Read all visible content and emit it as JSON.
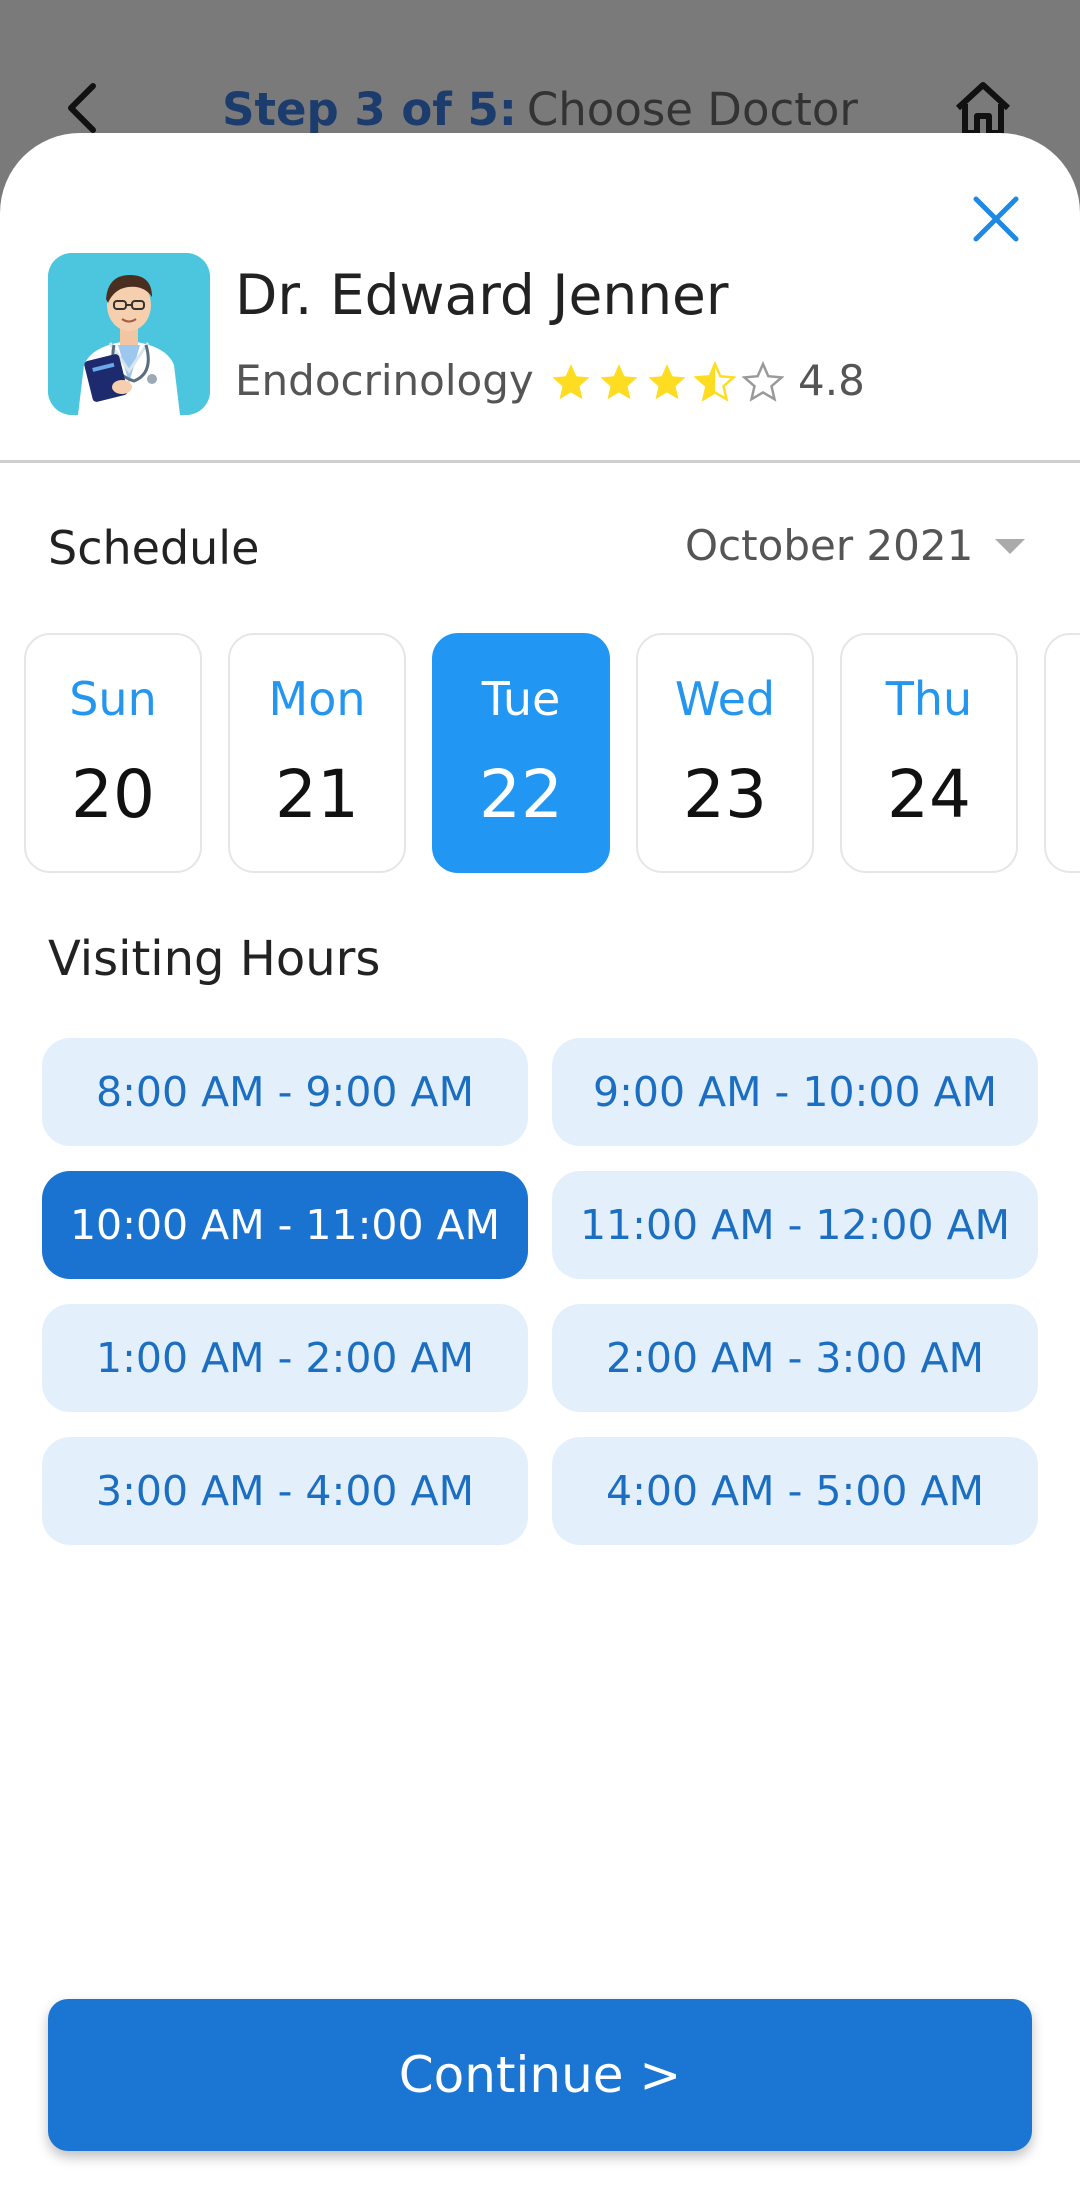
{
  "colors": {
    "accent": "#2196f3",
    "primary_button": "#1b75d3",
    "slot_bg": "#e3f0fb",
    "slot_text": "#1b6ec2",
    "star": "#fddc22",
    "overlay": "#777777"
  },
  "topbar": {
    "back_icon": "chevron-left-icon",
    "step": "Step 3 of 5:",
    "title": "Choose Doctor",
    "home_icon": "home-icon"
  },
  "sheet": {
    "close_icon": "close-icon"
  },
  "doctor": {
    "name": "Dr. Edward Jenner",
    "specialty": "Endocrinology",
    "stars": [
      1,
      1,
      1,
      0.5,
      0
    ],
    "rating": "4.8"
  },
  "schedule": {
    "label": "Schedule",
    "month": "October 2021",
    "days": [
      {
        "name": "Sun",
        "num": "20",
        "selected": false
      },
      {
        "name": "Mon",
        "num": "21",
        "selected": false
      },
      {
        "name": "Tue",
        "num": "22",
        "selected": true
      },
      {
        "name": "Wed",
        "num": "23",
        "selected": false
      },
      {
        "name": "Thu",
        "num": "24",
        "selected": false
      },
      {
        "name": "",
        "num": "",
        "selected": false
      }
    ]
  },
  "visiting": {
    "label": "Visiting Hours",
    "slots": [
      {
        "label": "8:00 AM - 9:00 AM",
        "selected": false
      },
      {
        "label": "9:00 AM - 10:00 AM",
        "selected": false
      },
      {
        "label": "10:00 AM - 11:00 AM",
        "selected": true
      },
      {
        "label": "11:00 AM - 12:00 AM",
        "selected": false
      },
      {
        "label": "1:00 AM - 2:00 AM",
        "selected": false
      },
      {
        "label": "2:00 AM - 3:00 AM",
        "selected": false
      },
      {
        "label": "3:00 AM - 4:00 AM",
        "selected": false
      },
      {
        "label": "4:00 AM - 5:00 AM",
        "selected": false
      }
    ]
  },
  "continue_label": "Continue >"
}
